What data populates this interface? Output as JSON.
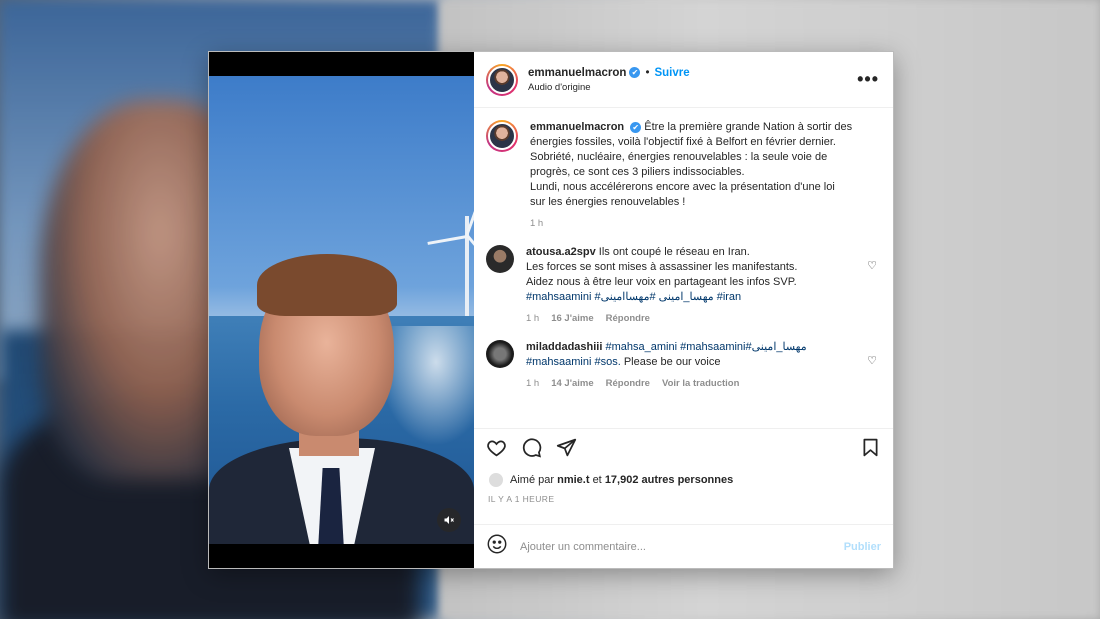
{
  "post": {
    "username": "emmanuelmacron",
    "follow_label": "Suivre",
    "dot": "•",
    "audio_label": "Audio d'origine",
    "more_label": "•••",
    "caption": {
      "username": "emmanuelmacron",
      "lines": [
        "Être la première grande Nation à sortir des",
        "énergies fossiles, voilà l'objectif fixé à Belfort en février dernier.",
        "Sobriété, nucléaire, énergies renouvelables : la seule voie de",
        "progrès, ce sont ces 3 piliers indissociables.",
        "Lundi, nous accélérerons encore avec la présentation d'une loi",
        "sur les énergies renouvelables !"
      ],
      "time": "1 h"
    },
    "comments": [
      {
        "username": "atousa.a2spv",
        "lines": [
          "Ils ont coupé le réseau en Iran.",
          "Les forces se sont mises à assassiner les manifestants.",
          "Aidez nous à être leur voix en partageant les infos SVP."
        ],
        "hashtags": "#mahsaamini #مهسا_امینی #مهساامینی #iran",
        "time": "1 h",
        "likes": "16 J'aime",
        "reply": "Répondre"
      },
      {
        "username": "miladdadashiii",
        "line1_tags": "#mahsa_amini #mahsaamini#مهسا_امینی",
        "line2_tags": "#mahsaamini #sos.",
        "line2_text": "Please be our voice",
        "time": "1 h",
        "likes": "14 J'aime",
        "reply": "Répondre",
        "translate": "Voir la traduction"
      }
    ],
    "liked_by": {
      "prefix": "Aimé par",
      "user": "nmie.t",
      "connector": "et",
      "others": "17,902 autres personnes"
    },
    "time_ago": "IL Y A 1 HEURE",
    "comment_placeholder": "Ajouter un commentaire...",
    "publish_label": "Publier"
  },
  "icons": {
    "verified": "✔",
    "heart_small": "♡",
    "mute": "🔇",
    "emoji": "emoji-icon"
  },
  "colors": {
    "link_blue": "#0095f6",
    "verified_blue": "#3897f0",
    "publish_disabled": "#b2dffc"
  }
}
